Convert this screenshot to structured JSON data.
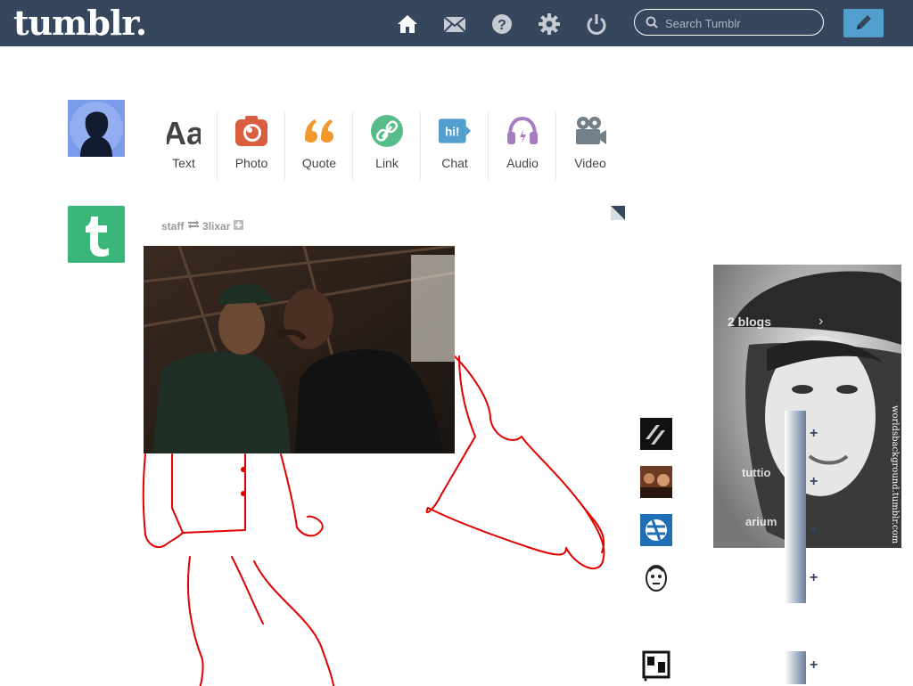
{
  "header": {
    "logo": "tumblr.",
    "search_placeholder": "Search Tumblr",
    "icons": [
      "home-icon",
      "mail-icon",
      "help-icon",
      "gear-icon",
      "power-icon"
    ],
    "compose_icon": "pencil-icon"
  },
  "post_types": [
    {
      "label": "Text",
      "icon": "text-icon",
      "color": "#444444"
    },
    {
      "label": "Photo",
      "icon": "camera-icon",
      "color": "#d95e40"
    },
    {
      "label": "Quote",
      "icon": "quote-icon",
      "color": "#f2992e"
    },
    {
      "label": "Link",
      "icon": "link-icon",
      "color": "#56bc8a"
    },
    {
      "label": "Chat",
      "icon": "chat-icon",
      "color": "#529ecc"
    },
    {
      "label": "Audio",
      "icon": "headphones-icon",
      "color": "#a77dc2"
    },
    {
      "label": "Video",
      "icon": "video-camera-icon",
      "color": "#748089"
    }
  ],
  "post": {
    "author": "staff",
    "reblogged_from": "3lixar"
  },
  "sidebar": {
    "blogs_link": "2 blogs",
    "portrait_text": "worldsbackground.tumblr.com",
    "recommended": [
      {
        "name": "",
        "icon": "blog-avatar-icon"
      },
      {
        "name": "tuttio",
        "icon": "blog-avatar-icon"
      },
      {
        "name": "arium",
        "icon": "blog-avatar-icon"
      },
      {
        "name": "",
        "icon": "blog-avatar-icon"
      },
      {
        "name": "",
        "icon": "blog-avatar-icon"
      }
    ],
    "plus_label": "+"
  },
  "colors": {
    "header_bg": "#36465d",
    "accent": "#529ecc",
    "staff_green": "#3bb67a",
    "doodle_red": "#e00000"
  }
}
